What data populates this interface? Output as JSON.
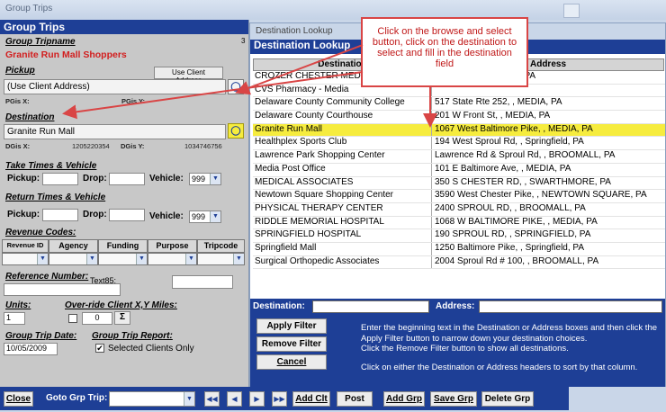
{
  "window_title": "Group Trips",
  "left": {
    "header": "Group Trips",
    "tripname_label": "Group Tripname",
    "tripname_count": "3",
    "tripname_value": "Granite Run Mall Shoppers",
    "pickup_label": "Pickup",
    "use_client_address_button": "Use Client Address",
    "pickup_value": "(Use Client Address)",
    "pgis_x_label": "PGis X:",
    "pgis_y_label": "PGis Y:",
    "destination_label": "Destination",
    "destination_value": "Granite Run Mall",
    "dgis_x_label": "DGis X:",
    "dgis_x_value": "1205220354",
    "dgis_y_label": "DGis Y:",
    "dgis_y_value": "1034746756",
    "take_times_label": "Take Times & Vehicle",
    "return_times_label": "Return Times & Vehicle",
    "pickup_time_label": "Pickup:",
    "drop_time_label": "Drop:",
    "vehicle_label": "Vehicle:",
    "vehicle_take_value": "999",
    "vehicle_return_value": "999",
    "revenue_codes_label": "Revenue Codes:",
    "revenue_columns": [
      "Revenue ID",
      "Agency",
      "Funding",
      "Purpose",
      "Tripcode"
    ],
    "reference_label": "Reference Number:",
    "text85_label": "Text85:",
    "units_label": "Units:",
    "units_value": "1",
    "override_label": "Over-ride Client X,Y Miles:",
    "override_value": "0",
    "sigma_button": "Σ",
    "trip_date_label": "Group Trip Date:",
    "trip_date_value": "10/05/2009",
    "trip_report_label": "Group Trip Report:",
    "selected_clients_label": "Selected Clients Only",
    "selected_clients_checked": "✔"
  },
  "lookup": {
    "window_title": "Destination Lookup",
    "header": "Destination Lookup",
    "col_destination": "Destination",
    "col_address": "Address",
    "rows": [
      {
        "dest": "CROZER CHESTER MED CENTER",
        "addr": "UPLAND, CHESTER, PA"
      },
      {
        "dest": "CVS Pharmacy - Media",
        "addr": ""
      },
      {
        "dest": "Delaware County Community College",
        "addr": "517 State Rte 252, , MEDIA, PA"
      },
      {
        "dest": "Delaware County Courthouse",
        "addr": "201 W Front St, , MEDIA, PA"
      },
      {
        "dest": "Granite Run Mall",
        "addr": "1067 West Baltimore Pike, , MEDIA, PA"
      },
      {
        "dest": "Healthplex Sports Club",
        "addr": "194 West Sproul Rd, , Springfield, PA"
      },
      {
        "dest": "Lawrence Park Shopping Center",
        "addr": "Lawrence Rd & Sproul Rd, , BROOMALL, PA"
      },
      {
        "dest": "Media Post Office",
        "addr": "101 E Baltimore Ave, , MEDIA, PA"
      },
      {
        "dest": "MEDICAL ASSOCIATES",
        "addr": "350 S CHESTER RD, , SWARTHMORE, PA"
      },
      {
        "dest": "Newtown Square Shopping Center",
        "addr": "3590 West Chester Pike, , NEWTOWN SQUARE, PA"
      },
      {
        "dest": "PHYSICAL THERAPY CENTER",
        "addr": "2400 SPROUL RD, , BROOMALL, PA"
      },
      {
        "dest": "RIDDLE MEMORIAL HOSPITAL",
        "addr": "1068 W BALTIMORE PIKE, , MEDIA, PA"
      },
      {
        "dest": "SPRINGFIELD HOSPITAL",
        "addr": "190 SPROUL RD, , SPRINGFIELD, PA"
      },
      {
        "dest": "Springfield Mall",
        "addr": "1250 Baltimore Pike, , Springfield, PA"
      },
      {
        "dest": "Surgical Orthopedic Associates",
        "addr": "2004 Sproul Rd # 100, , BROOMALL, PA"
      }
    ],
    "filter_dest_label": "Destination:",
    "filter_addr_label": "Address:",
    "apply_filter": "Apply Filter",
    "remove_filter": "Remove Filter",
    "cancel": "Cancel",
    "instr_1": "Enter the beginning text in the Destination or Address boxes and then click the Apply Filter button to narrow down your destination choices.",
    "instr_2": "Click the Remove Filter button to show all destinations.",
    "instr_3": "Click on either the Destination or Address headers to sort by that column."
  },
  "callout": "Click on the browse and select button, click on the destination to select and fill in the destination field",
  "bottom": {
    "close": "Close",
    "goto_label": "Goto Grp Trip:",
    "add_clt": "Add Clt",
    "post": "Post",
    "add_grp": "Add Grp",
    "save_grp": "Save Grp",
    "delete_grp": "Delete Grp"
  },
  "colors": {
    "accent": "#1e3f96",
    "highlight": "#f6ec3e",
    "callout_border": "#d94545"
  }
}
